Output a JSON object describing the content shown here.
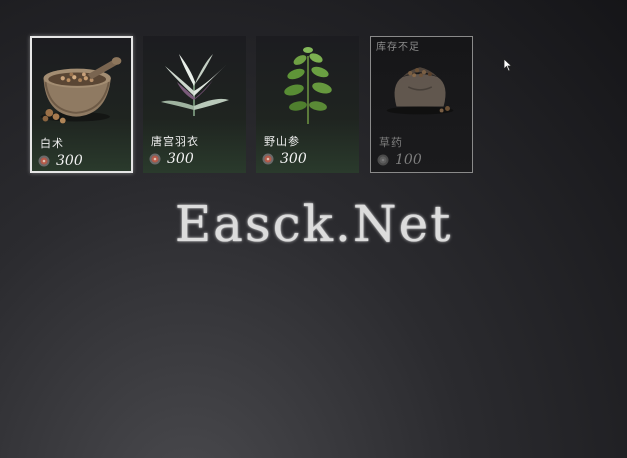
{
  "shop": {
    "items": [
      {
        "name": "白术",
        "price": "300",
        "icon": "mortar-herbs-icon",
        "state": "selected"
      },
      {
        "name": "唐宫羽衣",
        "price": "300",
        "icon": "feather-leaf-plant-icon",
        "state": "normal"
      },
      {
        "name": "野山参",
        "price": "300",
        "icon": "wild-ginseng-plant-icon",
        "state": "normal"
      },
      {
        "name": "草药",
        "price": "100",
        "icon": "herb-sack-icon",
        "state": "out-of-stock",
        "badge": "库存不足"
      }
    ],
    "currency_icon": "coin-icon"
  },
  "watermark": {
    "text": "Easck.Net"
  },
  "colors": {
    "selected_border": "#e6e6e6",
    "soldout_text": "#7d7d7d",
    "background": "#2b2b2f"
  }
}
